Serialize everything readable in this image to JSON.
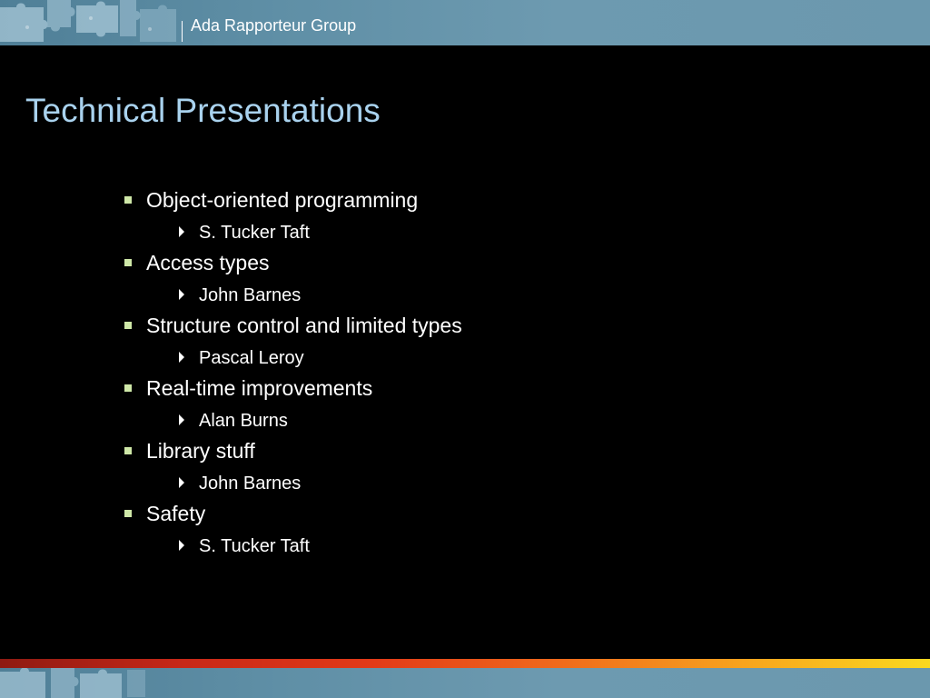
{
  "header": {
    "title": "Ada Rapporteur Group"
  },
  "slide": {
    "title": "Technical Presentations",
    "items": [
      {
        "topic": "Object-oriented programming",
        "presenter": "S. Tucker Taft"
      },
      {
        "topic": "Access types",
        "presenter": "John Barnes"
      },
      {
        "topic": "Structure control and limited types",
        "presenter": "Pascal Leroy"
      },
      {
        "topic": "Real-time improvements",
        "presenter": "Alan Burns"
      },
      {
        "topic": "Library stuff",
        "presenter": "John Barnes"
      },
      {
        "topic": "Safety",
        "presenter": "S. Tucker Taft"
      }
    ]
  },
  "colors": {
    "background": "#000000",
    "title": "#a9d2ee",
    "band": "#5f8fa6",
    "bullet_square": "#cfe8a8",
    "text": "#ffffff"
  },
  "icons": {
    "level1_bullet": "square-bullet-icon",
    "level2_bullet": "triangle-bullet-icon",
    "decoration": "puzzle-pieces-icon"
  }
}
